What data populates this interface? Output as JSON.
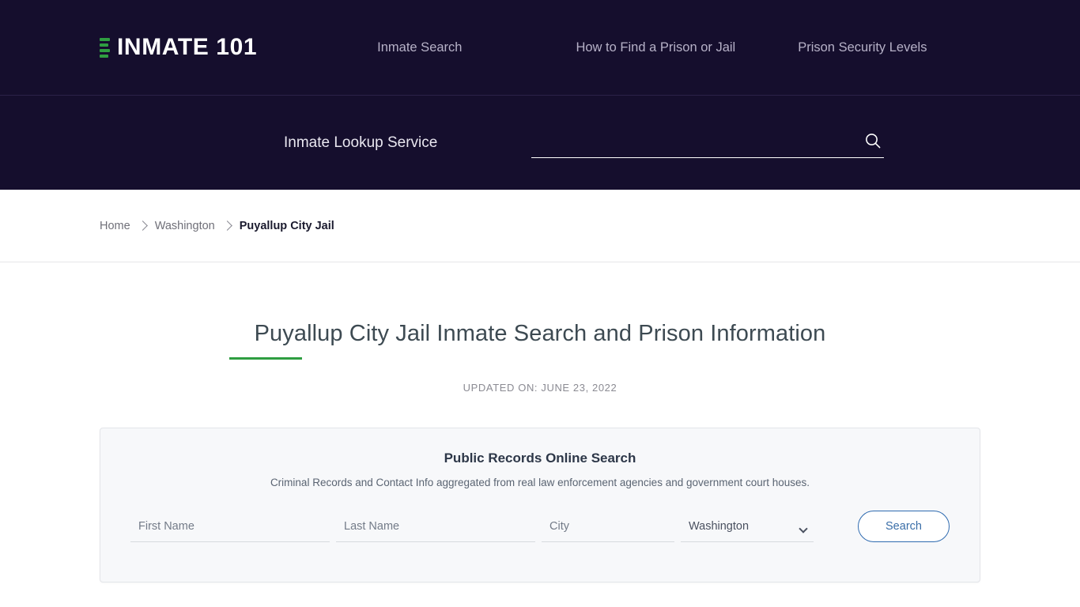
{
  "header": {
    "brand": {
      "name": "INMATE 101",
      "mark_color": "#2f9e41",
      "bars": 4
    },
    "nav": [
      {
        "label": "Inmate Search"
      },
      {
        "label": "How to Find a Prison or Jail"
      },
      {
        "label": "Prison Security Levels"
      }
    ],
    "lookup_label": "Inmate Lookup Service",
    "search": {
      "value": "",
      "placeholder": "",
      "icon": "search-icon"
    },
    "background_color": "#150E2D"
  },
  "breadcrumb": [
    {
      "label": "Home",
      "current": false
    },
    {
      "label": "Washington",
      "current": false
    },
    {
      "label": "Puyallup City Jail",
      "current": true
    }
  ],
  "main": {
    "title": "Puyallup City Jail Inmate Search and Prison Information",
    "title_rule_color": "#2f9e41",
    "updated_on": "UPDATED ON: JUNE 23, 2022"
  },
  "records_card": {
    "title": "Public Records Online Search",
    "subtitle": "Criminal Records and Contact Info aggregated from real law enforcement agencies and government court houses.",
    "fields": {
      "first_name": {
        "placeholder": "First Name",
        "value": ""
      },
      "last_name": {
        "placeholder": "Last Name",
        "value": ""
      },
      "city": {
        "placeholder": "City",
        "value": ""
      },
      "state": {
        "selected": "Washington",
        "options": [
          "Washington"
        ]
      }
    },
    "submit_label": "Search",
    "accent_color": "#2f6bb0"
  }
}
